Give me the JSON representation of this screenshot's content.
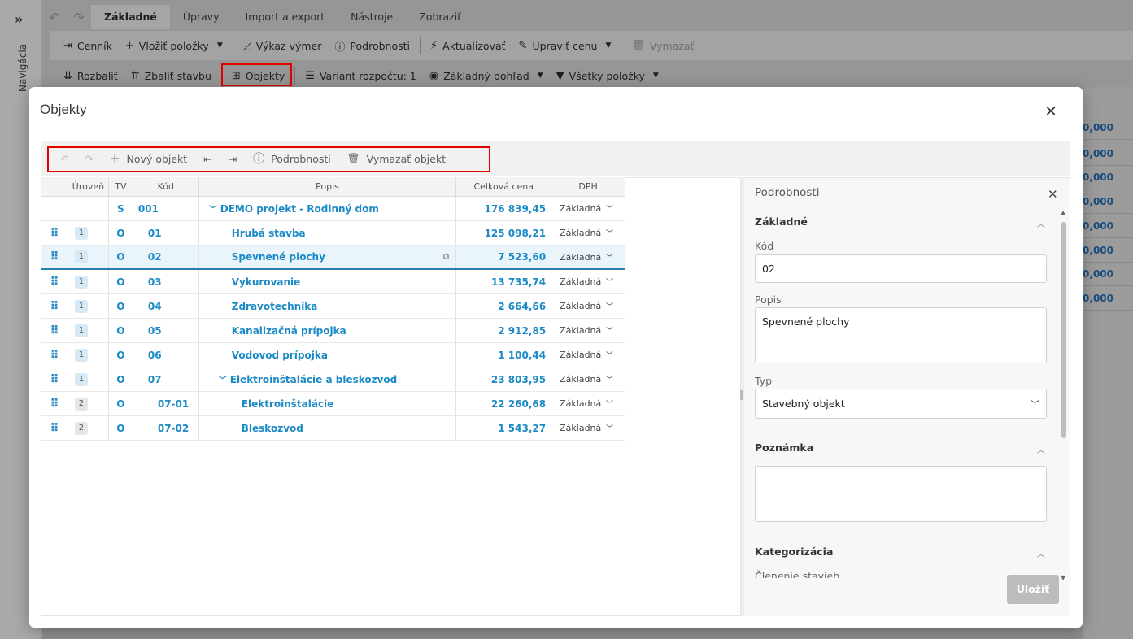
{
  "nav": {
    "label": "Navigácia"
  },
  "tabs": [
    "Základné",
    "Úpravy",
    "Import a export",
    "Nástroje",
    "Zobraziť"
  ],
  "toolbar1": {
    "cennik": "Cenník",
    "vlozit": "Vložiť položky",
    "vykaz": "Výkaz výmer",
    "podrobnosti": "Podrobnosti",
    "aktualizovat": "Aktualizovať",
    "upravit": "Upraviť cenu",
    "vymazat": "Vymazať"
  },
  "toolbar2": {
    "rozbalit": "Rozbaliť",
    "zbalit": "Zbaliť stavbu",
    "objekty": "Objekty",
    "variant": "Variant rozpočtu: 1",
    "pohlad": "Základný pohľad",
    "polozky": "Všetky položky"
  },
  "bg_values": [
    "0,000",
    "0,000",
    "0,000",
    "0,000",
    "0,000",
    "0,000",
    "0,000",
    "0,000"
  ],
  "modal": {
    "title": "Objekty",
    "toolbar": {
      "novy": "Nový objekt",
      "podrobnosti": "Podrobnosti",
      "vymazat": "Vymazať objekt"
    },
    "columns": [
      "Úroveň",
      "TV",
      "Kód",
      "Popis",
      "Celková cena",
      "DPH"
    ],
    "rows": [
      {
        "level": "",
        "tv": "S",
        "kod": "001",
        "popis": "DEMO projekt - Rodinný dom",
        "cena": "176 839,45",
        "dph": "Základná"
      },
      {
        "level": "1",
        "tv": "O",
        "kod": "01",
        "popis": "Hrubá stavba",
        "cena": "125 098,21",
        "dph": "Základná"
      },
      {
        "level": "1",
        "tv": "O",
        "kod": "02",
        "popis": "Spevnené plochy",
        "cena": "7 523,60",
        "dph": "Základná"
      },
      {
        "level": "1",
        "tv": "O",
        "kod": "03",
        "popis": "Vykurovanie",
        "cena": "13 735,74",
        "dph": "Základná"
      },
      {
        "level": "1",
        "tv": "O",
        "kod": "04",
        "popis": "Zdravotechnika",
        "cena": "2 664,66",
        "dph": "Základná"
      },
      {
        "level": "1",
        "tv": "O",
        "kod": "05",
        "popis": "Kanalizačná prípojka",
        "cena": "2 912,85",
        "dph": "Základná"
      },
      {
        "level": "1",
        "tv": "O",
        "kod": "06",
        "popis": "Vodovod prípojka",
        "cena": "1 100,44",
        "dph": "Základná"
      },
      {
        "level": "1",
        "tv": "O",
        "kod": "07",
        "popis": "Elektroinštalácie a bleskozvod",
        "cena": "23 803,95",
        "dph": "Základná"
      },
      {
        "level": "2",
        "tv": "O",
        "kod": "07-01",
        "popis": "Elektroinštalácie",
        "cena": "22 260,68",
        "dph": "Základná"
      },
      {
        "level": "2",
        "tv": "O",
        "kod": "07-02",
        "popis": "Bleskozvod",
        "cena": "1 543,27",
        "dph": "Základná"
      }
    ]
  },
  "details": {
    "title": "Podrobnosti",
    "sec_zakladne": "Základné",
    "kod_label": "Kód",
    "kod_value": "02",
    "popis_label": "Popis",
    "popis_value": "Spevnené plochy",
    "typ_label": "Typ",
    "typ_value": "Stavebný objekt",
    "sec_poznamka": "Poznámka",
    "sec_kategorizacia": "Kategorizácia",
    "clenenie_label": "Členenie stavieb",
    "save": "Uložiť"
  }
}
